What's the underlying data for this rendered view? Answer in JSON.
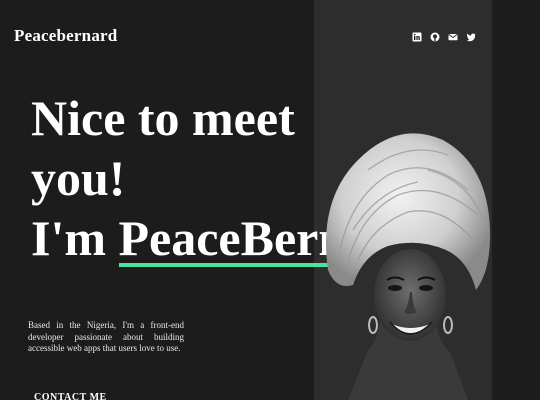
{
  "header": {
    "logo": "Peacebernard",
    "socials": [
      {
        "name": "linkedin-icon"
      },
      {
        "name": "github-icon"
      },
      {
        "name": "mail-icon"
      },
      {
        "name": "twitter-icon"
      }
    ]
  },
  "hero": {
    "line1": "Nice to meet",
    "line2": "you!",
    "line3_prefix": "I'm",
    "name": "PeaceBern",
    "bio": "Based in the Nigeria, I'm a front-end developer passionate about building accessible web apps that users love to use.",
    "contact_label": "CONTACT ME"
  },
  "colors": {
    "accent": "#4ee1a0",
    "background": "#1a1a1a",
    "panel": "#2d2d2d"
  }
}
